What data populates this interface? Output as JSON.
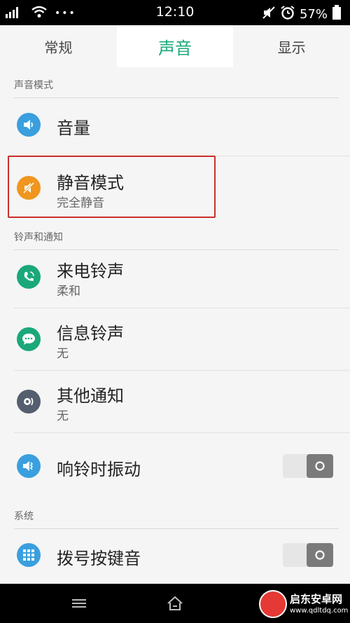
{
  "status_bar": {
    "time": "12:10",
    "battery": "57%",
    "dots": "•••",
    "icons": [
      "signal-icon",
      "wifi-icon",
      "mute-icon",
      "alarm-icon",
      "battery-icon"
    ]
  },
  "tabs": [
    {
      "label": "常规",
      "active": false
    },
    {
      "label": "声音",
      "active": true
    },
    {
      "label": "显示",
      "active": false
    }
  ],
  "sections": {
    "sound_mode": "声音模式",
    "ring_notify": "铃声和通知",
    "system": "系统"
  },
  "items": {
    "volume": {
      "title": "音量",
      "icon": "speaker-icon",
      "color": "#3a9fde"
    },
    "silent_mode": {
      "title": "静音模式",
      "subtitle": "完全静音",
      "icon": "mute-icon",
      "color": "#f0961e"
    },
    "ringtone": {
      "title": "来电铃声",
      "subtitle": "柔和",
      "icon": "phone-icon",
      "color": "#1aa87a"
    },
    "message_tone": {
      "title": "信息铃声",
      "subtitle": "无",
      "icon": "message-icon",
      "color": "#1aa87a"
    },
    "other_notify": {
      "title": "其他通知",
      "subtitle": "无",
      "icon": "notify-icon",
      "color": "#555e6e"
    },
    "vibrate_on_ring": {
      "title": "响铃时振动",
      "icon": "vibrate-icon",
      "color": "#3a9fde",
      "enabled": false
    },
    "dial_tone": {
      "title": "拨号按键音",
      "icon": "keypad-icon",
      "color": "#3a9fde",
      "enabled": false
    }
  },
  "nav": [
    "menu-icon",
    "home-icon",
    "back-icon"
  ],
  "watermark": {
    "name": "启东安卓网",
    "url": "www.qdltdq.com"
  }
}
